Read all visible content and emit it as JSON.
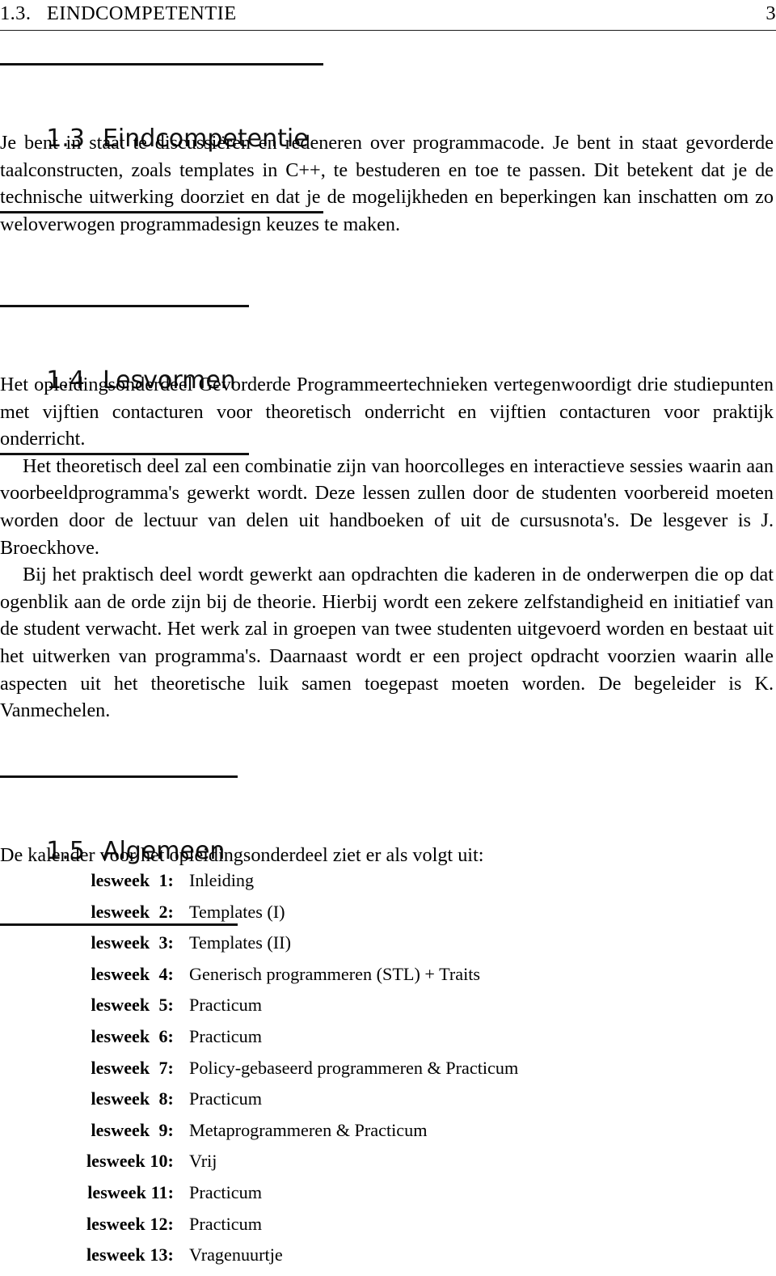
{
  "running_head": {
    "left": "1.3.   EINDCOMPETENTIE",
    "page_number": "3"
  },
  "sections": [
    {
      "number": "1.3",
      "title": "Eindcompetentie",
      "paragraphs": [
        "Je bent in staat te discussiëren en redeneren over programmacode. Je bent in staat gevorderde taalconstructen, zoals templates in C++, te bestuderen en toe te passen. Dit betekent dat je de technische uitwerking doorziet en dat je de mogelijkheden en beperkingen kan inschatten om zo weloverwogen programmadesign keuzes te maken."
      ]
    },
    {
      "number": "1.4",
      "title": "Lesvormen",
      "paragraphs": [
        "Het opleidingsonderdeel Gevorderde Programmeertechnieken vertegenwoordigt drie studiepunten met vijftien contacturen voor theoretisch onderricht en vijftien contacturen voor praktijk onderricht.",
        "Het theoretisch deel zal een combinatie zijn van hoorcolleges en interactieve sessies waarin aan voorbeeldprogramma's gewerkt wordt. Deze lessen zullen door de studenten voorbereid moeten worden door de lectuur van delen uit handboeken of uit de cursusnota's. De lesgever is J. Broeckhove.",
        "Bij het praktisch deel wordt gewerkt aan opdrachten die kaderen in de onderwerpen die op dat ogenblik aan de orde zijn bij de theorie. Hierbij wordt een zekere zelfstandigheid en initiatief van de student verwacht. Het werk zal in groepen van twee studenten uitgevoerd worden en bestaat uit het uitwerken van programma's. Daarnaast wordt er een project opdracht voorzien waarin alle aspecten uit het theoretische luik samen toegepast moeten worden. De begeleider is K. Vanmechelen."
      ]
    },
    {
      "number": "1.5",
      "title": "Algemeen",
      "paragraphs": [
        "De kalender voor het opleidingsonderdeel ziet er als volgt uit:"
      ]
    }
  ],
  "calendar": {
    "items": [
      {
        "label": "lesweek  1:",
        "description": "Inleiding"
      },
      {
        "label": "lesweek  2:",
        "description": "Templates (I)"
      },
      {
        "label": "lesweek  3:",
        "description": "Templates (II)"
      },
      {
        "label": "lesweek  4:",
        "description": "Generisch programmeren (STL) + Traits"
      },
      {
        "label": "lesweek  5:",
        "description": "Practicum"
      },
      {
        "label": "lesweek  6:",
        "description": "Practicum"
      },
      {
        "label": "lesweek  7:",
        "description": "Policy-gebaseerd programmeren & Practicum"
      },
      {
        "label": "lesweek  8:",
        "description": "Practicum"
      },
      {
        "label": "lesweek  9:",
        "description": "Metaprogrammeren & Practicum"
      },
      {
        "label": "lesweek 10:",
        "description": "Vrij"
      },
      {
        "label": "lesweek 11:",
        "description": "Practicum"
      },
      {
        "label": "lesweek 12:",
        "description": "Practicum"
      },
      {
        "label": "lesweek 13:",
        "description": "Vragenuurtje"
      }
    ]
  },
  "colors": {
    "text": "#000000",
    "rule": "#111111",
    "background": "#ffffff"
  }
}
